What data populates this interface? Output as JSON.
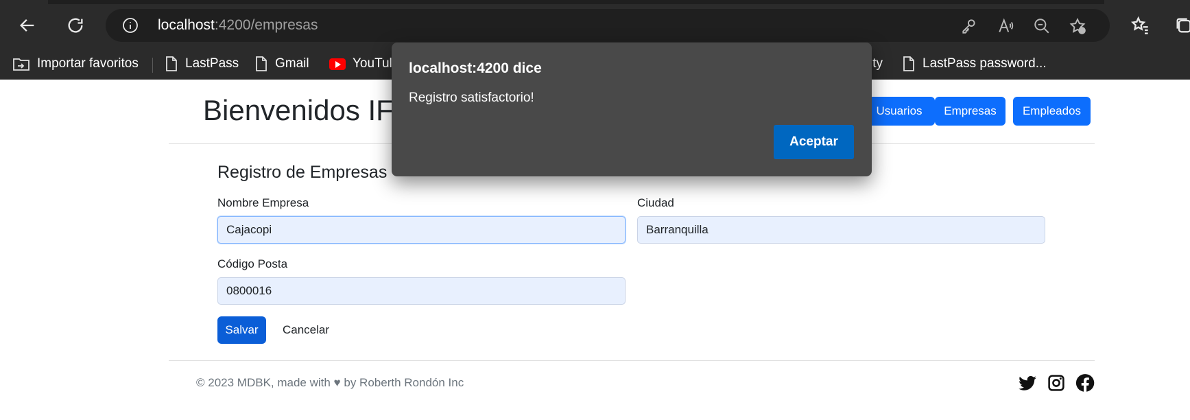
{
  "browser": {
    "url_host": "localhost",
    "url_rest": ":4200/empresas",
    "bookmarks": {
      "import": "Importar favoritos",
      "lastpass": "LastPass",
      "gmail": "Gmail",
      "youtube": "YouTul",
      "partial": "ity",
      "lastpass_pw": "LastPass password..."
    }
  },
  "header": {
    "title": "Bienvenidos IF",
    "nav": {
      "usuarios": "Usuarios",
      "empresas": "Empresas",
      "empleados": "Empleados"
    }
  },
  "form": {
    "title": "Registro de Empresas",
    "nombre_label": "Nombre Empresa",
    "nombre_value": "Cajacopi",
    "ciudad_label": "Ciudad",
    "ciudad_value": "Barranquilla",
    "codigo_label": "Código Posta",
    "codigo_value": "0800016",
    "save_label": "Salvar",
    "cancel_label": "Cancelar"
  },
  "footer": {
    "text": "© 2023 MDBK, made with ♥ by Roberth Rondón Inc"
  },
  "dialog": {
    "title": "localhost:4200 dice",
    "message": "Registro satisfactorio!",
    "ok_label": "Aceptar"
  },
  "colors": {
    "primary": "#0d6efd",
    "dialog_bg": "#494949",
    "dialog_button": "#0067c0",
    "input_bg": "#e8f0fe"
  },
  "icons": [
    "back-icon",
    "refresh-icon",
    "info-icon",
    "key-icon",
    "read-aloud-icon",
    "zoom-out-icon",
    "add-favorite-icon",
    "favorites-icon",
    "collections-icon",
    "folder-icon",
    "page-icon",
    "youtube-icon",
    "twitter-icon",
    "instagram-icon",
    "facebook-icon"
  ]
}
